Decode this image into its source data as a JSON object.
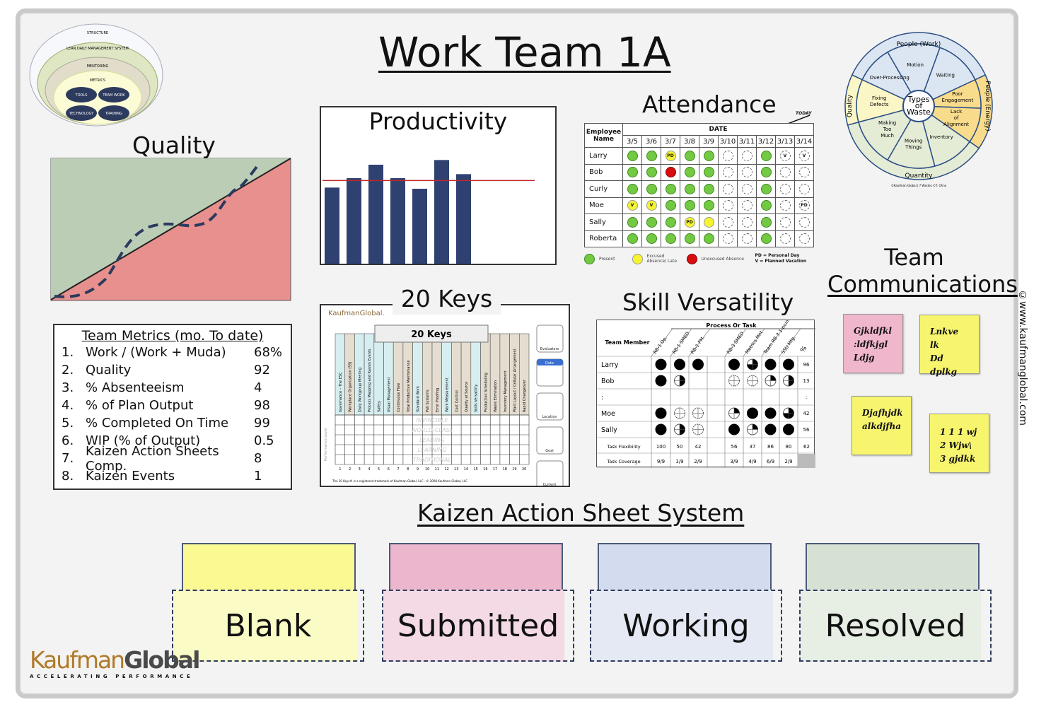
{
  "title": "Work Team 1A",
  "structure_diagram": {
    "rings": [
      "STRUCTURE",
      "LEAN DAILY MANAGEMENT SYSTEM",
      "MENTORING",
      "METRICS"
    ],
    "core": [
      "TOOLS",
      "TEAM WORK",
      "TECHNOLOGY",
      "TRAINING"
    ]
  },
  "quality": {
    "title": "Quality"
  },
  "productivity": {
    "title": "Productivity",
    "bars": [
      323,
      363,
      420,
      363,
      318,
      440,
      380
    ],
    "target": 353,
    "colors": {
      "bar": "#2f4170",
      "target": "#c0282b"
    }
  },
  "attendance": {
    "title": "Attendance",
    "name_header": "Employee Name",
    "date_header": "DATE",
    "today_label": "TODAY",
    "dates": [
      "3/5",
      "3/6",
      "3/7",
      "3/8",
      "3/9",
      "3/10",
      "3/11",
      "3/12",
      "3/13",
      "3/14"
    ],
    "rows": [
      {
        "name": "Larry",
        "cells": [
          "G",
          "G",
          "Y:PD",
          "G",
          "G",
          "E",
          "E",
          "G",
          "E:V",
          "E:V"
        ]
      },
      {
        "name": "Bob",
        "cells": [
          "G",
          "G",
          "R",
          "G",
          "G",
          "E",
          "E",
          "G",
          "E",
          "E"
        ]
      },
      {
        "name": "Curly",
        "cells": [
          "G",
          "G",
          "G",
          "G",
          "G",
          "E",
          "E",
          "G",
          "E",
          "E"
        ]
      },
      {
        "name": "Moe",
        "cells": [
          "Y:V",
          "Y:V",
          "G",
          "G",
          "G",
          "E",
          "E",
          "G",
          "E",
          "E:PD"
        ]
      },
      {
        "name": "Sally",
        "cells": [
          "G",
          "G",
          "G",
          "Y:PD",
          "Y",
          "E",
          "E",
          "G",
          "E",
          "E"
        ]
      },
      {
        "name": "Roberta",
        "cells": [
          "G",
          "G",
          "G",
          "G",
          "G",
          "E",
          "E",
          "G",
          "E",
          "E"
        ]
      }
    ],
    "legend": {
      "present": "Present",
      "excused": "Excused Absence/ Late",
      "unexcused": "Unexcused Absence",
      "pd": "PD = Personal Day",
      "v": "V = Planned Vacation"
    }
  },
  "waste_wheel": {
    "center": "Types of Waste",
    "groups": [
      "People (Work)",
      "People (Energy)",
      "Quantity",
      "Quality"
    ],
    "segments": [
      "Motion",
      "Waiting",
      "Poor Engagement",
      "Lack of Alignment",
      "Inventory",
      "Moving Things",
      "Making Too Much",
      "Fixing Defects",
      "Over-Processing"
    ],
    "credit": "©Kaufman Global | 7 Wastes ©T. Ohno"
  },
  "team_communications": {
    "title_line1": "Team",
    "title_line2": "Communications",
    "notes": [
      {
        "lines": [
          "Gjkldfkl",
          ":ldfkjgl",
          "Ldjg"
        ],
        "color": "#f0b6cc"
      },
      {
        "lines": [
          "Lnkve  lk",
          "Dd  dplkg"
        ],
        "color": "#f7f56e"
      },
      {
        "lines": [
          "Djafhjdk",
          "alkdjfha"
        ],
        "color": "#f7f56e"
      },
      {
        "lines": [
          "1   1 1 wj",
          "2   Wjw\\",
          "3   gjdkk"
        ],
        "color": "#f7f56e"
      }
    ]
  },
  "team_metrics": {
    "title": "Team Metrics (mo. To date)",
    "items": [
      {
        "n": "1.",
        "label": "Work / (Work + Muda)",
        "value": "68%"
      },
      {
        "n": "2.",
        "label": "Quality",
        "value": "92"
      },
      {
        "n": "3.",
        "label": "% Absenteeism",
        "value": "4"
      },
      {
        "n": "4.",
        "label": "% of Plan Output",
        "value": "98"
      },
      {
        "n": "5.",
        "label": "% Completed On Time",
        "value": "99"
      },
      {
        "n": "6.",
        "label": "WIP (% of Output)",
        "value": "0.5"
      },
      {
        "n": "7.",
        "label": "Kaizen Action Sheets Comp.",
        "value": "8"
      },
      {
        "n": "8.",
        "label": "Kaizen Events",
        "value": "1"
      }
    ]
  },
  "twenty_keys": {
    "title": "20 Keys",
    "sheet_title": "20 Keys",
    "logo": "KaufmanGlobal.",
    "axis_label": "Performance Level",
    "keys": [
      "Governance – The ESC",
      "Workplace Organization (5S)",
      "Daily Workgroup Meeting",
      "Process Mapping and Kaizen Events",
      "Safety",
      "Visual Management",
      "Continuous Flow",
      "Total Productive Maintenance",
      "Standard Work",
      "Pull Systems",
      "Error Proofing",
      "Work Measurement",
      "Cost Control",
      "Quality at Source",
      "Skills Versatility",
      "Production Scheduling",
      "Waste Elimination",
      "Inventory Management",
      "Plant Layout / Cellular Arrangement",
      "Rapid Changeover"
    ],
    "key_colors": [
      "t",
      "b",
      "t",
      "t",
      "t",
      "t",
      "b",
      "b",
      "t",
      "b",
      "b",
      "t",
      "b",
      "b",
      "t",
      "b",
      "b",
      "b",
      "b",
      "b"
    ],
    "levels": [
      "INVINCIBLE",
      "WORLD-CLASS",
      "LEADING",
      "LEARNING",
      "TRADITIONAL"
    ],
    "side": [
      "Evaluators",
      "Date",
      "Location",
      "Goal",
      "Current"
    ],
    "footer": "The 20 Keys® is a registered trademark of Kaufman Global, LLC - © 2008 Kaufman Global, LLC"
  },
  "skill_versatility": {
    "title": "Skill Versatility",
    "member_header": "Team Member",
    "process_header": "Process Or Task",
    "tasks": [
      "RB-1 Op.",
      "RB-1 SMED",
      "RB-1 PM.",
      "",
      "RB-3 SMED",
      "Metrics Mnt",
      "Team RB-3 1-points",
      "SSU Mtg."
    ],
    "pct_header": "%",
    "rows": [
      {
        "name": "Larry",
        "levels": [
          4,
          4,
          4,
          null,
          4,
          3,
          4,
          4
        ],
        "pct": "96"
      },
      {
        "name": "Bob",
        "levels": [
          4,
          2,
          null,
          null,
          0,
          0,
          1,
          2
        ],
        "pct": "13"
      },
      {
        "name": ":",
        "levels": [
          null,
          null,
          null,
          null,
          null,
          null,
          null,
          null
        ],
        "pct": ":"
      },
      {
        "name": "Moe",
        "levels": [
          4,
          0,
          0,
          null,
          1,
          4,
          4,
          3
        ],
        "pct": "42"
      },
      {
        "name": "Sally",
        "levels": [
          4,
          2,
          0,
          null,
          4,
          1,
          4,
          4
        ],
        "pct": "56"
      }
    ],
    "flex_label": "Task Flexibility",
    "flex": [
      "100",
      "50",
      "42",
      "",
      "56",
      "37",
      "86",
      "80",
      "62"
    ],
    "cov_label": "Task Coverage",
    "cov": [
      "9/9",
      "1/9",
      "2/9",
      "",
      "3/9",
      "4/9",
      "6/9",
      "2/9",
      ""
    ]
  },
  "kaizen": {
    "title": "Kaizen Action Sheet System",
    "cards": [
      {
        "label": "Blank",
        "top": "#fbfa92",
        "bottom": "#fbfbc6"
      },
      {
        "label": "Submitted",
        "top": "#ecb6cc",
        "bottom": "#f4dae5"
      },
      {
        "label": "Working",
        "top": "#d3dcee",
        "bottom": "#e4e9f4"
      },
      {
        "label": "Resolved",
        "top": "#d6e1d3",
        "bottom": "#e7eee4"
      }
    ]
  },
  "logo": {
    "part1": "Kaufman",
    "part2": "Global",
    "tagline": "ACCELERATING PERFORMANCE"
  },
  "website": "©www.kaufmanglobal.com"
}
